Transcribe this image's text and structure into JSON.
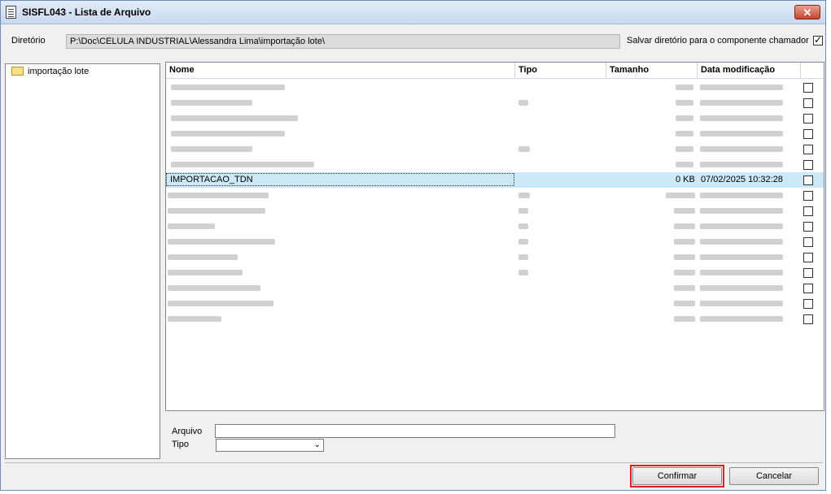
{
  "window": {
    "title": "SISFL043 - Lista de Arquivo",
    "close_label": "✕"
  },
  "directory": {
    "label": "Diretório",
    "path": "P:\\Doc\\CELULA INDUSTRIAL\\Alessandra Lima\\importação lote\\",
    "save_label": "Salvar diretório para o componente chamador",
    "save_checked": true
  },
  "tree": {
    "items": [
      {
        "label": "importação lote",
        "icon": "folder-icon"
      }
    ]
  },
  "file_list": {
    "columns": [
      "Nome",
      "Tipo",
      "Tamanho",
      "Data modificação"
    ],
    "selected_row": {
      "name": "IMPORTACAO_TDN",
      "type": "",
      "size": "0 KB",
      "modified": "07/02/2025 10:32:28"
    }
  },
  "form": {
    "file_label": "Arquivo",
    "file_value": "",
    "type_label": "Tipo",
    "type_value": ""
  },
  "buttons": {
    "confirm": "Confirmar",
    "cancel": "Cancelar"
  }
}
